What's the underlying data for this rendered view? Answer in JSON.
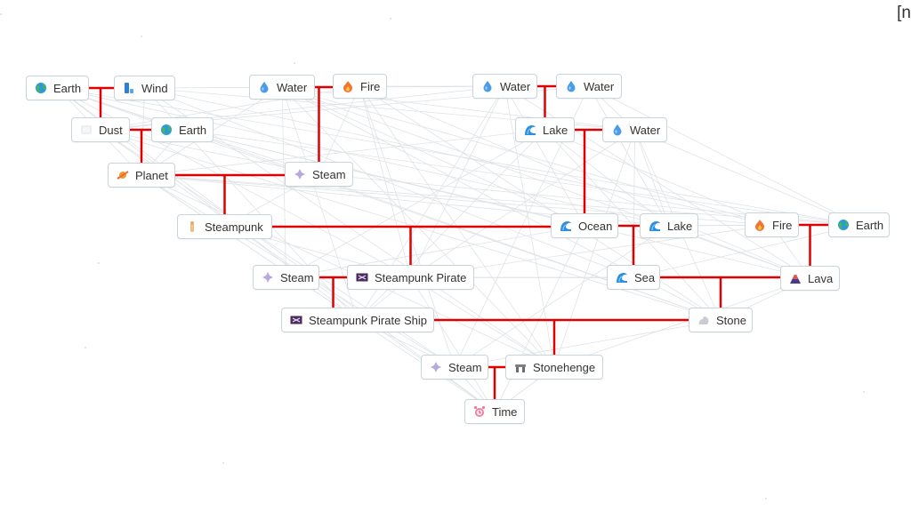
{
  "corner_text": "[n",
  "colors": {
    "link": "#e00000",
    "faint_link": "#dfe3e6",
    "node_border": "#c9d3da"
  },
  "nodes": [
    {
      "id": "earth1",
      "label": "Earth",
      "icon": "earth-icon"
    },
    {
      "id": "wind",
      "label": "Wind",
      "icon": "wind-icon"
    },
    {
      "id": "dust",
      "label": "Dust",
      "icon": "dust-icon"
    },
    {
      "id": "earth2",
      "label": "Earth",
      "icon": "earth-icon"
    },
    {
      "id": "planet",
      "label": "Planet",
      "icon": "planet-icon"
    },
    {
      "id": "water1",
      "label": "Water",
      "icon": "water-icon"
    },
    {
      "id": "fire1",
      "label": "Fire",
      "icon": "fire-icon"
    },
    {
      "id": "steam1",
      "label": "Steam",
      "icon": "steam-icon"
    },
    {
      "id": "steampunk",
      "label": "Steampunk",
      "icon": "steampunk-icon"
    },
    {
      "id": "water2",
      "label": "Water",
      "icon": "water-icon"
    },
    {
      "id": "water3",
      "label": "Water",
      "icon": "water-icon"
    },
    {
      "id": "lake1",
      "label": "Lake",
      "icon": "wave-icon"
    },
    {
      "id": "water4",
      "label": "Water",
      "icon": "water-icon"
    },
    {
      "id": "ocean",
      "label": "Ocean",
      "icon": "wave-icon"
    },
    {
      "id": "lake2",
      "label": "Lake",
      "icon": "wave-icon"
    },
    {
      "id": "fire2",
      "label": "Fire",
      "icon": "fire-icon"
    },
    {
      "id": "earth3",
      "label": "Earth",
      "icon": "earth-icon"
    },
    {
      "id": "steam2",
      "label": "Steam",
      "icon": "steam-icon"
    },
    {
      "id": "spirate",
      "label": "Steampunk Pirate",
      "icon": "pirate-flag-icon"
    },
    {
      "id": "sea",
      "label": "Sea",
      "icon": "wave-icon"
    },
    {
      "id": "lava",
      "label": "Lava",
      "icon": "volcano-icon"
    },
    {
      "id": "spship",
      "label": "Steampunk Pirate Ship",
      "icon": "pirate-flag-icon"
    },
    {
      "id": "stone",
      "label": "Stone",
      "icon": "stone-icon"
    },
    {
      "id": "steam3",
      "label": "Steam",
      "icon": "steam-icon"
    },
    {
      "id": "stonehenge",
      "label": "Stonehenge",
      "icon": "stonehenge-icon"
    },
    {
      "id": "time",
      "label": "Time",
      "icon": "alarm-clock-icon"
    }
  ],
  "recipes": [
    {
      "inputs": [
        "earth1",
        "wind"
      ],
      "result": "dust"
    },
    {
      "inputs": [
        "dust",
        "earth2"
      ],
      "result": "planet"
    },
    {
      "inputs": [
        "water1",
        "fire1"
      ],
      "result": "steam1"
    },
    {
      "inputs": [
        "planet",
        "steam1"
      ],
      "result": "steampunk"
    },
    {
      "inputs": [
        "water2",
        "water3"
      ],
      "result": "lake1"
    },
    {
      "inputs": [
        "lake1",
        "water4"
      ],
      "result": "ocean"
    },
    {
      "inputs": [
        "steampunk",
        "ocean"
      ],
      "result": "spirate"
    },
    {
      "inputs": [
        "ocean",
        "lake2"
      ],
      "result": "sea"
    },
    {
      "inputs": [
        "fire2",
        "earth3"
      ],
      "result": "lava"
    },
    {
      "inputs": [
        "steam2",
        "spirate"
      ],
      "result": "spship"
    },
    {
      "inputs": [
        "sea",
        "lava"
      ],
      "result": "stone"
    },
    {
      "inputs": [
        "spship",
        "stone"
      ],
      "result": "stonehenge"
    },
    {
      "inputs": [
        "steam3",
        "stonehenge"
      ],
      "result": "time"
    }
  ]
}
